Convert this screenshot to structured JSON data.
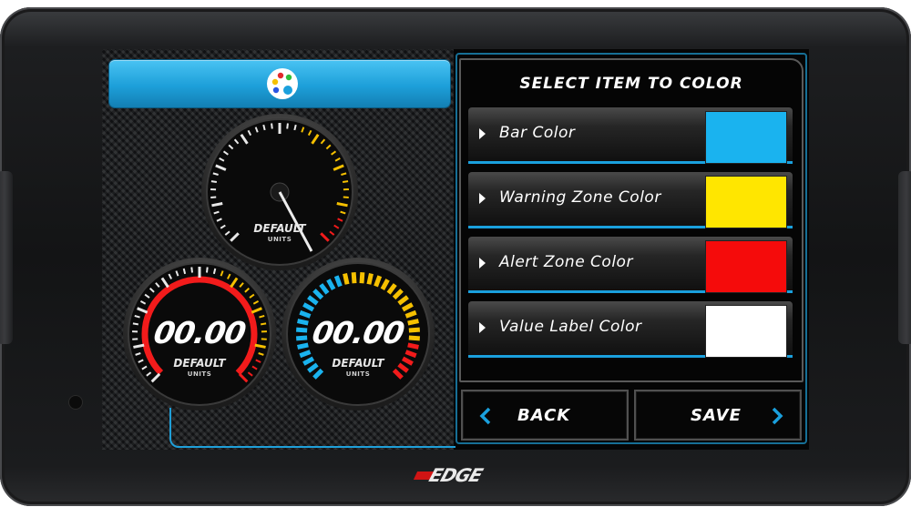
{
  "panel": {
    "title": "SELECT ITEM TO COLOR",
    "items": [
      {
        "label": "Bar Color",
        "color": "#1ab3ef"
      },
      {
        "label": "Warning Zone Color",
        "color": "#ffe600"
      },
      {
        "label": "Alert Zone Color",
        "color": "#f50b0b"
      },
      {
        "label": "Value Label Color",
        "color": "#ffffff"
      }
    ]
  },
  "buttons": {
    "back": "BACK",
    "save": "SAVE"
  },
  "gauges": {
    "top": {
      "label": "DEFAULT",
      "unit": "UNITS"
    },
    "left": {
      "value": "00.00",
      "label": "DEFAULT",
      "unit": "UNITS"
    },
    "right": {
      "value": "00.00",
      "label": "DEFAULT",
      "unit": "UNITS"
    }
  },
  "logo": {
    "text": "EDGE"
  },
  "icons": {
    "palette": "palette-icon",
    "back": "chevron-left-icon",
    "save": "chevron-right-icon"
  },
  "theme": {
    "accent": "#1aa0dd"
  }
}
